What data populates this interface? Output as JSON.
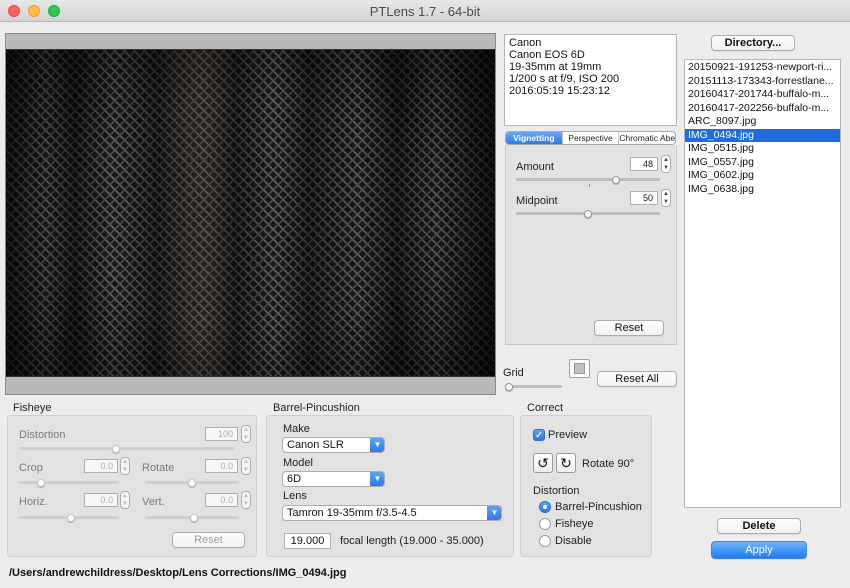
{
  "window": {
    "title": "PTLens 1.7 - 64-bit"
  },
  "exif": {
    "lines": [
      "Canon",
      "Canon EOS 6D",
      "19-35mm at 19mm",
      "1/200 s at f/9, ISO 200",
      "2016:05:19 15:23:12"
    ]
  },
  "tabs": [
    {
      "label": "Vignetting",
      "active": true
    },
    {
      "label": "Perspective",
      "active": false
    },
    {
      "label": "Chromatic Aberration",
      "active": false
    }
  ],
  "vignetting": {
    "amount_label": "Amount",
    "amount_value": "48",
    "midpoint_label": "Midpoint",
    "midpoint_value": "50",
    "reset_label": "Reset"
  },
  "grid": {
    "label": "Grid",
    "reset_all_label": "Reset All"
  },
  "files": {
    "directory_button": "Directory...",
    "items": [
      "20150921-191253-newport-ri...",
      "20151113-173343-forrestlane...",
      "20160417-201744-buffalo-m...",
      "20160417-202256-buffalo-m...",
      "ARC_8097.jpg",
      "IMG_0494.jpg",
      "IMG_0515.jpg",
      "IMG_0557.jpg",
      "IMG_0602.jpg",
      "IMG_0638.jpg"
    ],
    "selected": "IMG_0494.jpg",
    "delete_button": "Delete",
    "apply_button": "Apply"
  },
  "fisheye": {
    "title": "Fisheye",
    "distortion_label": "Distortion",
    "distortion_value": "100",
    "crop_label": "Crop",
    "crop_value": "0.0",
    "rotate_label": "Rotate",
    "rotate_value": "0.0",
    "horiz_label": "Horiz.",
    "horiz_value": "0.0",
    "vert_label": "Vert.",
    "vert_value": "0.0",
    "reset_label": "Reset"
  },
  "barrel": {
    "title": "Barrel-Pincushion",
    "make_label": "Make",
    "make_value": "Canon SLR",
    "model_label": "Model",
    "model_value": "6D",
    "lens_label": "Lens",
    "lens_value": "Tamron 19-35mm f/3.5-4.5",
    "focal_value": "19.000",
    "focal_label": "focal length (19.000 - 35.000)"
  },
  "correct": {
    "title": "Correct",
    "preview_label": "Preview",
    "rotate_label": "Rotate 90°",
    "distortion_label": "Distortion",
    "options": [
      "Barrel-Pincushion",
      "Fisheye",
      "Disable"
    ],
    "selected_option": "Barrel-Pincushion"
  },
  "status": {
    "path": "/Users/andrewchildress/Desktop/Lens Corrections/IMG_0494.jpg"
  }
}
